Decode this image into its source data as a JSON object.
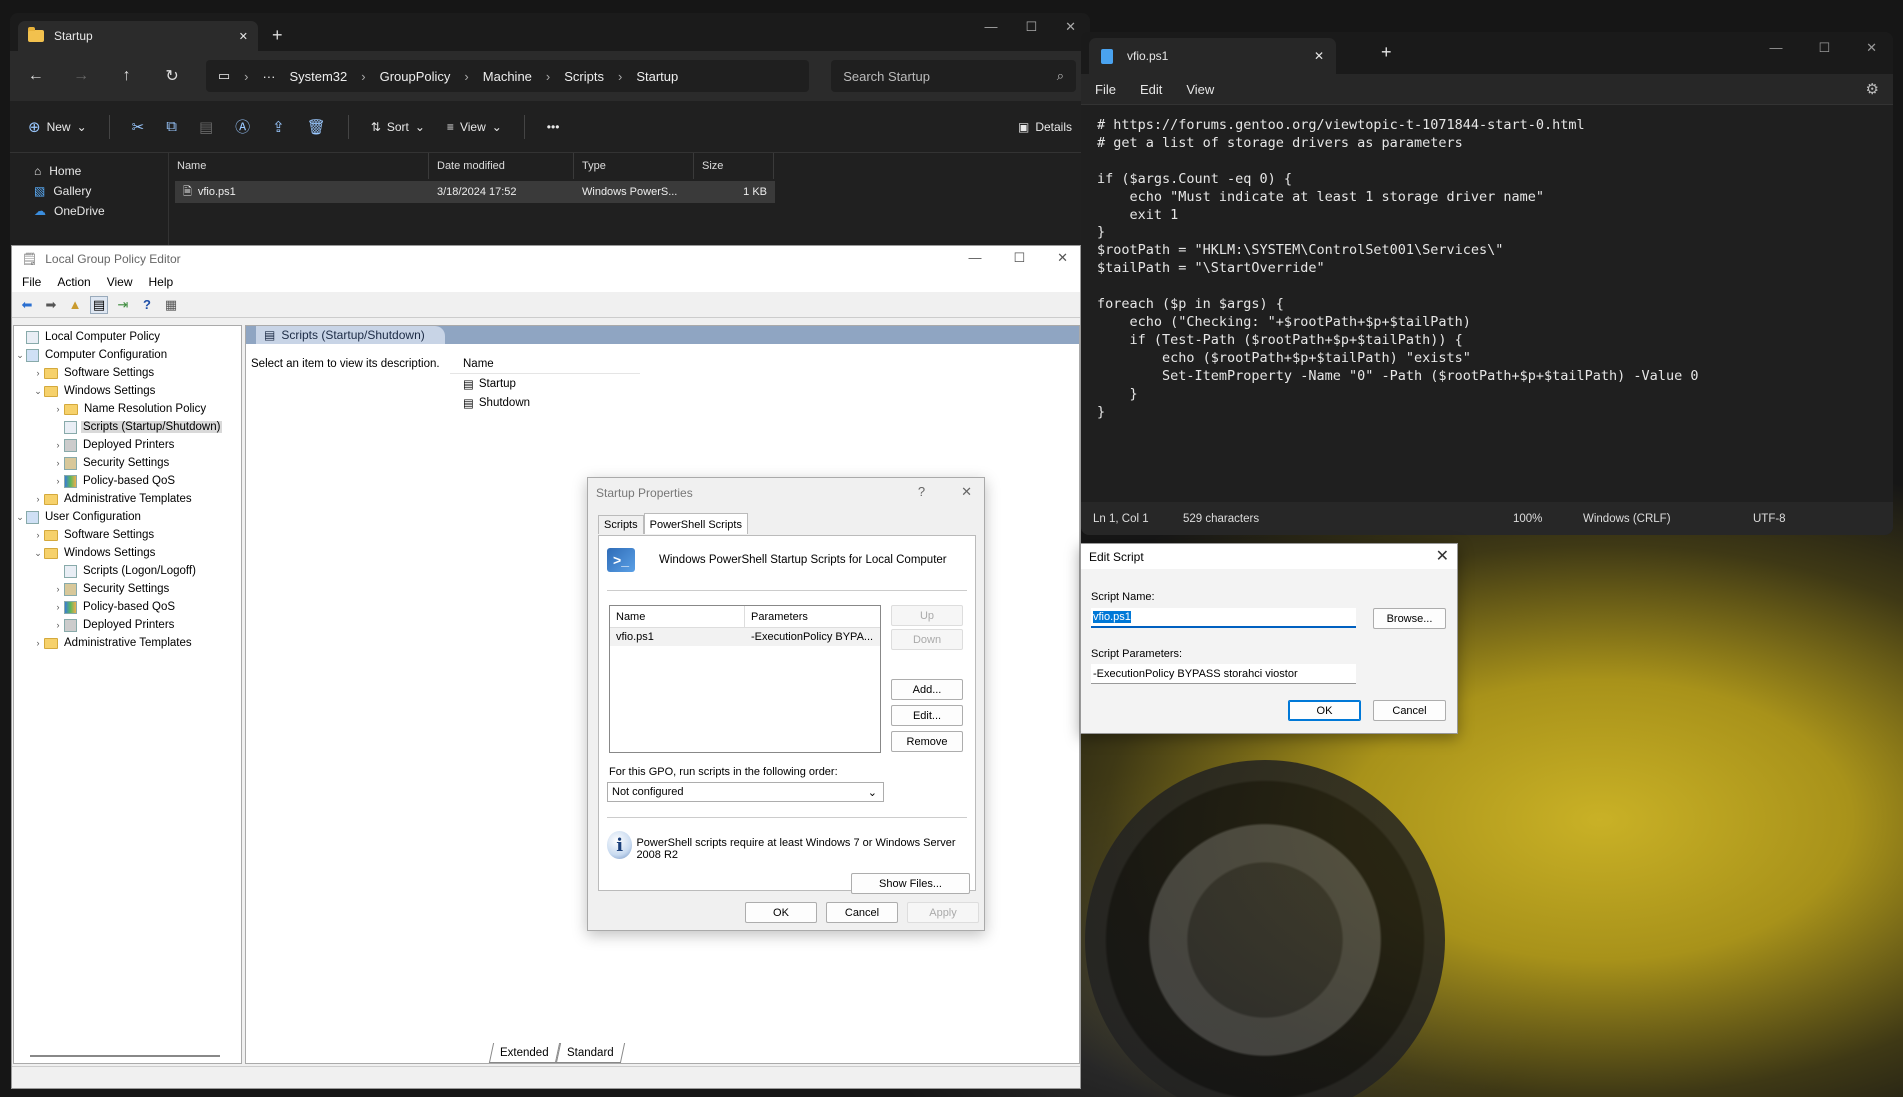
{
  "explorer": {
    "tab_title": "Startup",
    "breadcrumbs": [
      "System32",
      "GroupPolicy",
      "Machine",
      "Scripts",
      "Startup"
    ],
    "search_placeholder": "Search Startup",
    "toolbar": {
      "new": "New",
      "sort": "Sort",
      "view": "View",
      "details": "Details"
    },
    "nav": [
      "Home",
      "Gallery",
      "OneDrive"
    ],
    "columns": [
      "Name",
      "Date modified",
      "Type",
      "Size"
    ],
    "rows": [
      {
        "name": "vfio.ps1",
        "date": "3/18/2024 17:52",
        "type": "Windows PowerS...",
        "size": "1 KB"
      }
    ]
  },
  "gpedit": {
    "title": "Local Group Policy Editor",
    "menu": [
      "File",
      "Action",
      "View",
      "Help"
    ],
    "tree": [
      "Local Computer Policy",
      "Computer Configuration",
      "Software Settings",
      "Windows Settings",
      "Name Resolution Policy",
      "Scripts (Startup/Shutdown)",
      "Deployed Printers",
      "Security Settings",
      "Policy-based QoS",
      "Administrative Templates",
      "User Configuration",
      "Software Settings",
      "Windows Settings",
      "Scripts (Logon/Logoff)",
      "Security Settings",
      "Policy-based QoS",
      "Deployed Printers",
      "Administrative Templates"
    ],
    "pane_title": "Scripts (Startup/Shutdown)",
    "description": "Select an item to view its description.",
    "col_name": "Name",
    "items": [
      "Startup",
      "Shutdown"
    ],
    "bottom_tabs": [
      "Extended",
      "Standard"
    ]
  },
  "startup_props": {
    "title": "Startup Properties",
    "help": "?",
    "tabs": [
      "Scripts",
      "PowerShell Scripts"
    ],
    "heading": "Windows PowerShell Startup Scripts for Local Computer",
    "list_cols": [
      "Name",
      "Parameters"
    ],
    "list_rows": [
      {
        "name": "vfio.ps1",
        "params": "-ExecutionPolicy BYPA..."
      }
    ],
    "buttons": {
      "up": "Up",
      "down": "Down",
      "add": "Add...",
      "edit": "Edit...",
      "remove": "Remove",
      "show_files": "Show Files...",
      "ok": "OK",
      "cancel": "Cancel",
      "apply": "Apply"
    },
    "order_label": "For this GPO, run scripts in the following order:",
    "order_value": "Not configured",
    "info": "PowerShell scripts require at least Windows 7 or Windows Server 2008 R2"
  },
  "notepad": {
    "tab_title": "vfio.ps1",
    "menu": [
      "File",
      "Edit",
      "View"
    ],
    "content": "# https://forums.gentoo.org/viewtopic-t-1071844-start-0.html\n# get a list of storage drivers as parameters\n\nif ($args.Count -eq 0) {\n    echo \"Must indicate at least 1 storage driver name\"\n    exit 1\n}\n$rootPath = \"HKLM:\\SYSTEM\\ControlSet001\\Services\\\"\n$tailPath = \"\\StartOverride\"\n\nforeach ($p in $args) {\n    echo (\"Checking: \"+$rootPath+$p+$tailPath)\n    if (Test-Path ($rootPath+$p+$tailPath)) {\n        echo ($rootPath+$p+$tailPath) \"exists\"\n        Set-ItemProperty -Name \"0\" -Path ($rootPath+$p+$tailPath) -Value 0\n    }\n}",
    "status": {
      "position": "Ln 1, Col 1",
      "chars": "529 characters",
      "zoom": "100%",
      "eol": "Windows (CRLF)",
      "encoding": "UTF-8"
    }
  },
  "edit_script": {
    "title": "Edit Script",
    "name_label": "Script Name:",
    "name_value": "vfio.ps1",
    "params_label": "Script Parameters:",
    "params_value": "-ExecutionPolicy BYPASS storahci viostor",
    "browse": "Browse...",
    "ok": "OK",
    "cancel": "Cancel"
  }
}
